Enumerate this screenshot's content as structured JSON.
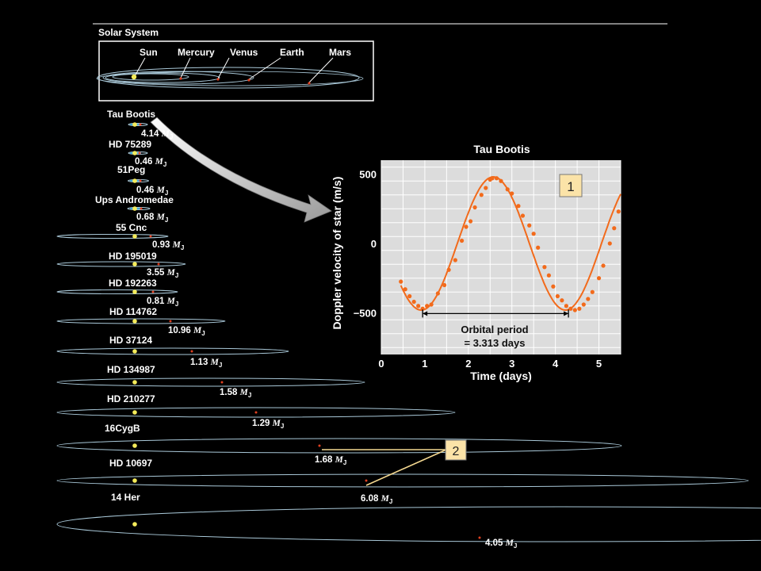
{
  "solar_system": {
    "title": "Solar System",
    "bodies": [
      {
        "name": "Sun",
        "color": "#f5ec5a"
      },
      {
        "name": "Mercury",
        "color": "#e04020"
      },
      {
        "name": "Venus",
        "color": "#e04020"
      },
      {
        "name": "Earth",
        "color": "#e04020"
      },
      {
        "name": "Mars",
        "color": "#e04020"
      }
    ]
  },
  "systems": [
    {
      "name": "Tau Bootis",
      "mass": "4.14"
    },
    {
      "name": "HD 75289",
      "mass": "0.46"
    },
    {
      "name": "51Peg",
      "mass": "0.46"
    },
    {
      "name": "Ups Andromedae",
      "mass": "0.68"
    },
    {
      "name": "55 Cnc",
      "mass": "0.93"
    },
    {
      "name": "HD 195019",
      "mass": "3.55"
    },
    {
      "name": "HD 192263",
      "mass": "0.81"
    },
    {
      "name": "HD 114762",
      "mass": "10.96"
    },
    {
      "name": "HD 37124",
      "mass": "1.13"
    },
    {
      "name": "HD 134987",
      "mass": "1.58"
    },
    {
      "name": "HD 210277",
      "mass": "1.29"
    },
    {
      "name": "16CygB",
      "mass": "1.68"
    },
    {
      "name": "HD 10697",
      "mass": "6.08"
    },
    {
      "name": "14 Her",
      "mass": "4.05"
    }
  ],
  "mass_unit": "M",
  "mass_unit_sub": "J",
  "callouts": {
    "one": "1",
    "two": "2"
  },
  "colors": {
    "star": "#f5ec5a",
    "planet": "#e04020",
    "orbit": "#a9c8d8",
    "curve": "#f26a1b",
    "plot_bg": "#dcdcdc",
    "callout_bg": "#fbe3a8"
  },
  "chart_data": {
    "type": "line",
    "title": "Tau Bootis",
    "xlabel": "Time (days)",
    "ylabel": "Doppler velocity of star (m/s)",
    "xlim": [
      0,
      5.5
    ],
    "ylim": [
      -800,
      600
    ],
    "xticks": [
      0,
      1,
      2,
      3,
      4,
      5
    ],
    "yticks": [
      -500,
      0,
      500
    ],
    "grid": true,
    "annotation": {
      "line1": "Orbital period",
      "line2": "= 3.313 days",
      "from": 0.95,
      "to": 4.3
    },
    "amplitude": 480,
    "period": 3.313,
    "points": [
      {
        "x": 0.45,
        "y": -275
      },
      {
        "x": 0.55,
        "y": -330
      },
      {
        "x": 0.65,
        "y": -380
      },
      {
        "x": 0.75,
        "y": -420
      },
      {
        "x": 0.85,
        "y": -450
      },
      {
        "x": 0.95,
        "y": -470
      },
      {
        "x": 1.05,
        "y": -450
      },
      {
        "x": 1.15,
        "y": -440
      },
      {
        "x": 1.3,
        "y": -360
      },
      {
        "x": 1.45,
        "y": -300
      },
      {
        "x": 1.55,
        "y": -190
      },
      {
        "x": 1.7,
        "y": -120
      },
      {
        "x": 1.85,
        "y": 20
      },
      {
        "x": 1.95,
        "y": 120
      },
      {
        "x": 2.05,
        "y": 160
      },
      {
        "x": 2.15,
        "y": 260
      },
      {
        "x": 2.3,
        "y": 350
      },
      {
        "x": 2.4,
        "y": 400
      },
      {
        "x": 2.5,
        "y": 460
      },
      {
        "x": 2.55,
        "y": 470
      },
      {
        "x": 2.65,
        "y": 470
      },
      {
        "x": 2.75,
        "y": 450
      },
      {
        "x": 2.9,
        "y": 390
      },
      {
        "x": 3.0,
        "y": 360
      },
      {
        "x": 3.15,
        "y": 270
      },
      {
        "x": 3.25,
        "y": 200
      },
      {
        "x": 3.4,
        "y": 130
      },
      {
        "x": 3.5,
        "y": 70
      },
      {
        "x": 3.6,
        "y": -30
      },
      {
        "x": 3.75,
        "y": -170
      },
      {
        "x": 3.85,
        "y": -230
      },
      {
        "x": 3.95,
        "y": -310
      },
      {
        "x": 4.05,
        "y": -380
      },
      {
        "x": 4.15,
        "y": -410
      },
      {
        "x": 4.25,
        "y": -450
      },
      {
        "x": 4.35,
        "y": -470
      },
      {
        "x": 4.45,
        "y": -480
      },
      {
        "x": 4.55,
        "y": -470
      },
      {
        "x": 4.65,
        "y": -440
      },
      {
        "x": 4.75,
        "y": -400
      },
      {
        "x": 4.85,
        "y": -350
      },
      {
        "x": 5.0,
        "y": -250
      },
      {
        "x": 5.1,
        "y": -160
      },
      {
        "x": 5.25,
        "y": 0
      },
      {
        "x": 5.35,
        "y": 110
      },
      {
        "x": 5.45,
        "y": 230
      }
    ]
  }
}
